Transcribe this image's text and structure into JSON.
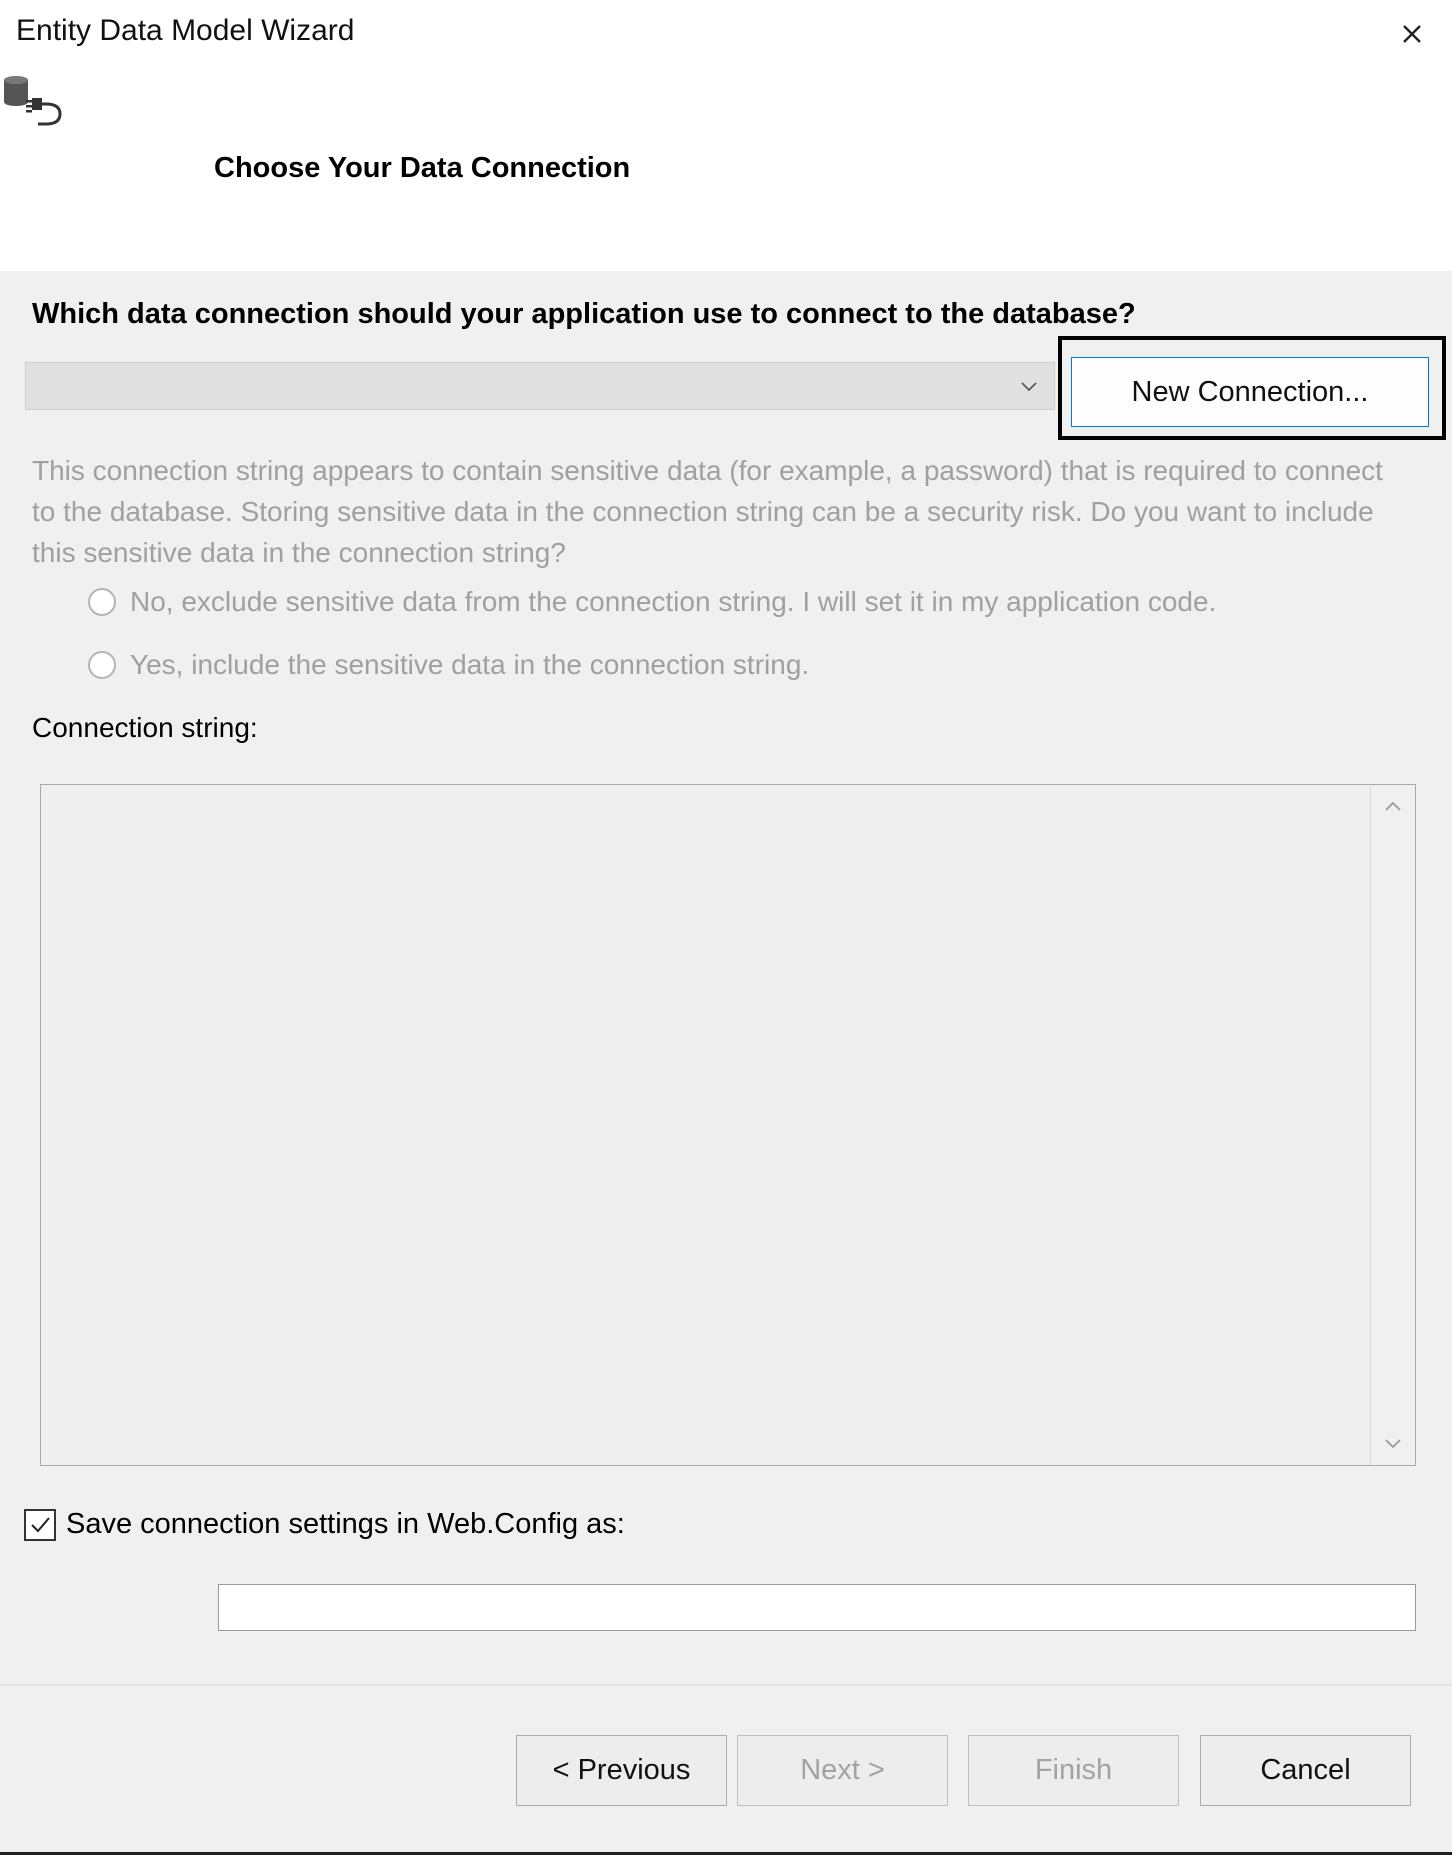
{
  "window": {
    "title": "Entity Data Model Wizard",
    "close_icon": "close-icon"
  },
  "header": {
    "logo_icon": "database-plug-icon",
    "heading": "Choose Your Data Connection"
  },
  "connection": {
    "question": "Which data connection should your application use to connect to the database?",
    "selected": "",
    "new_button_label": "New Connection..."
  },
  "sensitive": {
    "message": "This connection string appears to contain sensitive data (for example, a password) that is required to connect to the database. Storing sensitive data in the connection string can be a security risk. Do you want to include this sensitive data in the connection string?",
    "option_no": "No, exclude sensitive data from the connection string. I will set it in my application code.",
    "option_yes": "Yes, include the sensitive data in the connection string."
  },
  "connection_string": {
    "label": "Connection string:",
    "value": ""
  },
  "save": {
    "checked": true,
    "label": "Save connection settings in Web.Config as:",
    "name_value": ""
  },
  "footer": {
    "previous_label": "< Previous",
    "next_label": "Next >",
    "finish_label": "Finish",
    "cancel_label": "Cancel"
  },
  "colors": {
    "accent": "#0078d7",
    "disabled_text": "#a0a0a0",
    "dialog_bg": "#f0f0f0"
  }
}
